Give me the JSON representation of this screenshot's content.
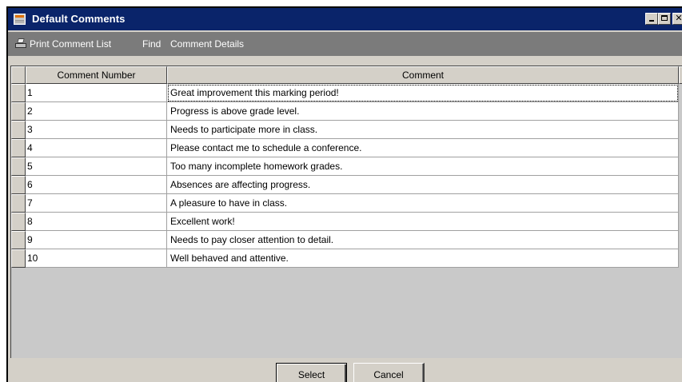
{
  "window": {
    "title": "Default Comments"
  },
  "toolbar": {
    "print_label": "Print Comment List",
    "find_label": "Find",
    "details_label": "Comment Details"
  },
  "grid": {
    "columns": [
      "Comment Number",
      "Comment"
    ],
    "rows": [
      {
        "number": "1",
        "comment": "Great improvement this marking period!"
      },
      {
        "number": "2",
        "comment": "Progress is above grade level."
      },
      {
        "number": "3",
        "comment": "Needs to participate more in class."
      },
      {
        "number": "4",
        "comment": "Please contact me to schedule a conference."
      },
      {
        "number": "5",
        "comment": "Too many incomplete homework grades."
      },
      {
        "number": "6",
        "comment": "Absences are affecting progress."
      },
      {
        "number": "7",
        "comment": "A pleasure to have in class."
      },
      {
        "number": "8",
        "comment": "Excellent work!"
      },
      {
        "number": "9",
        "comment": "Needs to pay closer attention to detail."
      },
      {
        "number": "10",
        "comment": "Well behaved and attentive."
      }
    ]
  },
  "buttons": {
    "select_label": "Select",
    "cancel_label": "Cancel"
  },
  "colors": {
    "titlebar": "#0a246a",
    "toolbar": "#7b7b7b",
    "window_face": "#d4d0c8"
  },
  "icons": {
    "window": "app-window-icon",
    "print": "printer-icon"
  }
}
